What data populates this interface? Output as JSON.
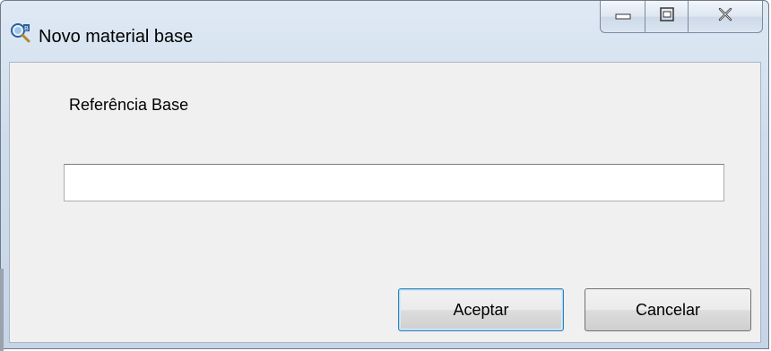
{
  "window": {
    "title": "Novo material base",
    "app_icon": "search-key-icon"
  },
  "caption_buttons": {
    "minimize_icon": "minimize-icon",
    "maximize_icon": "maximize-icon",
    "close_icon": "close-icon"
  },
  "form": {
    "reference_label": "Referência Base",
    "reference_value": "",
    "reference_placeholder": ""
  },
  "buttons": {
    "accept_label": "Aceptar",
    "cancel_label": "Cancelar"
  },
  "colors": {
    "client_background": "#f0f0f0",
    "default_button_border": "#3c7fb1"
  }
}
